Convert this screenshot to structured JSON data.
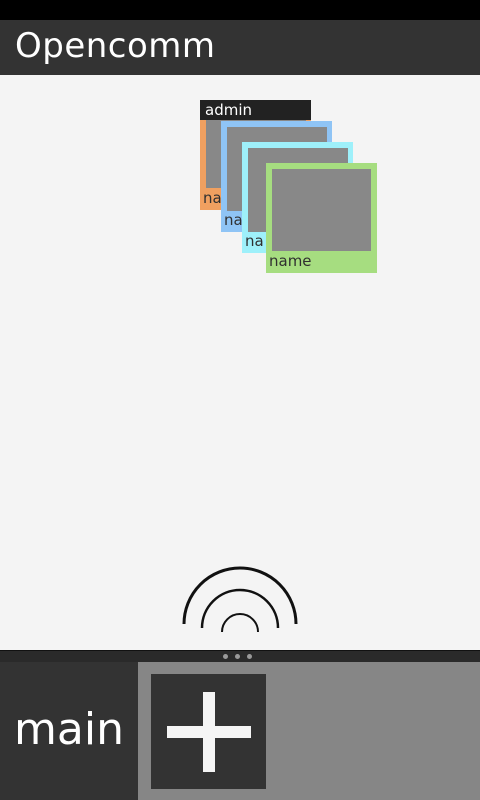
{
  "app": {
    "title": "Opencomm"
  },
  "group": {
    "admin_label": "admin",
    "members": [
      {
        "name": "name",
        "color": "#f0a060"
      },
      {
        "name": "na",
        "color": "#8fc4f5"
      },
      {
        "name": "na",
        "color": "#9ef0fa"
      },
      {
        "name": "name",
        "color": "#a6dd80"
      }
    ]
  },
  "bottom": {
    "channel_label": "main",
    "add_icon": "plus-icon"
  },
  "icons": {
    "signal": "signal-waves-icon",
    "handle": "drawer-handle-dots"
  }
}
